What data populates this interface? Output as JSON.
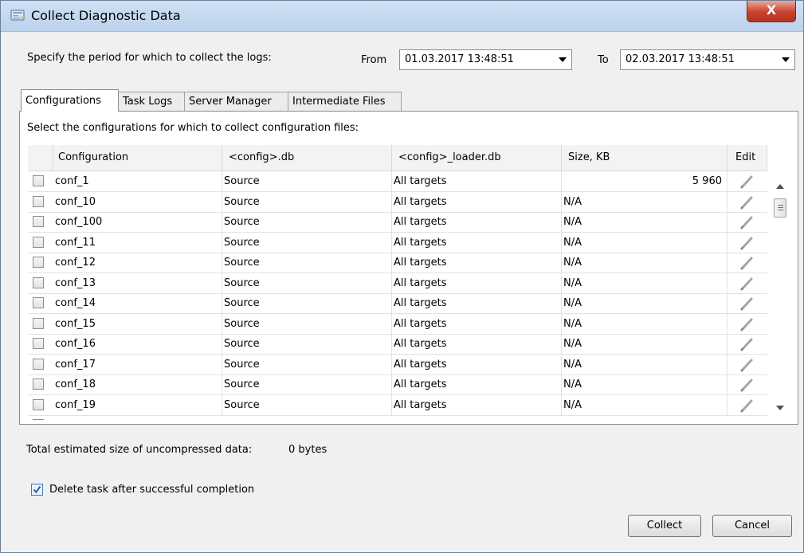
{
  "window": {
    "title": "Collect Diagnostic Data",
    "close_label": "X"
  },
  "period": {
    "prompt": "Specify the period for which to collect the logs:",
    "from_label": "From",
    "from_value": "01.03.2017 13:48:51",
    "to_label": "To",
    "to_value": "02.03.2017 13:48:51"
  },
  "tabs": [
    {
      "label": "Configurations",
      "active": true
    },
    {
      "label": "Task Logs",
      "active": false
    },
    {
      "label": "Server Manager",
      "active": false
    },
    {
      "label": "Intermediate Files",
      "active": false
    }
  ],
  "configurations": {
    "instruction": "Select the configurations for which to collect configuration files:",
    "columns": [
      "Configuration",
      "<config>.db",
      "<config>_loader.db",
      "Size, KB",
      "Edit"
    ],
    "rows": [
      {
        "name": "conf_1",
        "db": "Source",
        "loader": "All targets",
        "size": "5 960"
      },
      {
        "name": "conf_10",
        "db": "Source",
        "loader": "All targets",
        "size": "N/A"
      },
      {
        "name": "conf_100",
        "db": "Source",
        "loader": "All targets",
        "size": "N/A"
      },
      {
        "name": "conf_11",
        "db": "Source",
        "loader": "All targets",
        "size": "N/A"
      },
      {
        "name": "conf_12",
        "db": "Source",
        "loader": "All targets",
        "size": "N/A"
      },
      {
        "name": "conf_13",
        "db": "Source",
        "loader": "All targets",
        "size": "N/A"
      },
      {
        "name": "conf_14",
        "db": "Source",
        "loader": "All targets",
        "size": "N/A"
      },
      {
        "name": "conf_15",
        "db": "Source",
        "loader": "All targets",
        "size": "N/A"
      },
      {
        "name": "conf_16",
        "db": "Source",
        "loader": "All targets",
        "size": "N/A"
      },
      {
        "name": "conf_17",
        "db": "Source",
        "loader": "All targets",
        "size": "N/A"
      },
      {
        "name": "conf_18",
        "db": "Source",
        "loader": "All targets",
        "size": "N/A"
      },
      {
        "name": "conf_19",
        "db": "Source",
        "loader": "All targets",
        "size": "N/A"
      }
    ]
  },
  "summary": {
    "label": "Total estimated size of uncompressed data:",
    "value": "0 bytes"
  },
  "options": {
    "delete_task_label": "Delete task after successful completion",
    "delete_task_checked": true
  },
  "buttons": {
    "collect": "Collect",
    "cancel": "Cancel"
  },
  "colors": {
    "title_bar": "#c4d7ee",
    "close_button": "#c7412c",
    "check_mark": "#2a5ea8"
  }
}
